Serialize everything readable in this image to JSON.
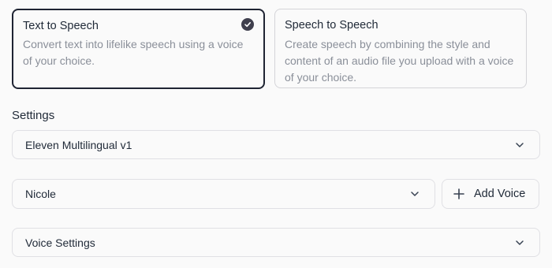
{
  "modes": [
    {
      "title": "Text to Speech",
      "description": "Convert text into lifelike speech using a voice of your choice.",
      "selected": true
    },
    {
      "title": "Speech to Speech",
      "description": "Create speech by combining the style and content of an audio file you upload with a voice of your choice.",
      "selected": false
    }
  ],
  "settings": {
    "heading": "Settings",
    "model_select": {
      "value": "Eleven Multilingual v1"
    },
    "voice_select": {
      "value": "Nicole"
    },
    "add_voice_label": "Add Voice",
    "voice_settings_label": "Voice Settings"
  },
  "icons": {
    "selected_check": "check-circle-icon",
    "dropdown": "chevron-down-icon",
    "add": "plus-icon"
  },
  "colors": {
    "selected_border": "#1f2433",
    "muted_text": "#8a8f99",
    "border": "#e0e0e4"
  }
}
